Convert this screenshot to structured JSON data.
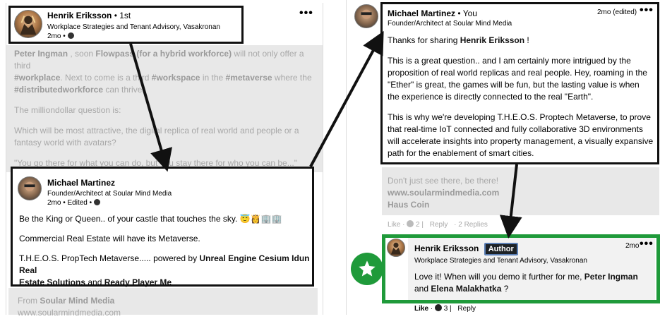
{
  "left_post": {
    "author_name": "Henrik Eriksson",
    "author_degree": "• 1st",
    "author_title": "Workplace Strategies and Tenant Advisory, Vasakronan",
    "author_meta": "2mo •",
    "more": "•••",
    "para1_a": "Peter Ingman",
    "para1_b": " , soon ",
    "para1_c": "Flowpass (for a hybrid workforce)",
    "para1_d": " will not only offer a third",
    "para1_e": "#workplace",
    "para1_f": ". Next to come is a third ",
    "para1_g": "#workspace",
    "para1_h": " in the ",
    "para1_i": "#metaverse",
    "para1_j": " where the",
    "para1_k": "#distributedworkforce",
    "para1_l": " can thrive.",
    "para2": "The milliondollar question is:",
    "para3_line1": "Which will be most attractive, the digital replica of real world and people or a",
    "para3_line2": "fantasy world with avatars?",
    "para4": "\"You go there for what you can do, but you stay there for who you can be...\""
  },
  "left_comment": {
    "author_name": "Michael Martinez",
    "author_title": "Founder/Architect at Soular Mind Media",
    "author_meta": "2mo • Edited •",
    "line1": "Be the King or Queen.. of your castle that touches the sky.",
    "line1_emoji": "😇👸🏢🏢",
    "line2": "Commercial Real Estate will have its Metaverse.",
    "line3_a": "T.H.E.O.S. PropTech Metaverse..... powered by ",
    "line3_b": "Unreal Engine Cesium Idun Real",
    "line3_c": "Estate Solutions",
    "line3_d": " and ",
    "line3_e": "Ready Player Me",
    "below_a": "From ",
    "below_b": "Soular Mind Media",
    "below_c": "www.soularmindmedia.com"
  },
  "right_comment": {
    "author_name": "Michael Martinez",
    "author_degree": "• You",
    "author_title": "Founder/Architect at Soular Mind Media",
    "time": "2mo (edited)",
    "more": "•••",
    "thanks_a": "Thanks for sharing ",
    "thanks_b": "Henrik Eriksson",
    "thanks_c": " !",
    "p1_l1": "This is a great question.. and I am certainly more intrigued by the",
    "p1_l2": "proposition of real world replicas and real people. Hey, roaming in the",
    "p1_l3": "\"Ether\" is great, the games will be fun, but the lasting value is when",
    "p1_l4": "the experience is directly connected to the real \"Earth\".",
    "p2_l1": "This is why we're developing T.H.E.O.S. Proptech Metaverse, to prove",
    "p2_l2": "that real-time IoT connected and fully collaborative 3D environments",
    "p2_l3": "will accelerate insights into property management, a visually expansive",
    "p2_l4": "path for the enablement of smart cities.",
    "below_l1": "Don't just see there, be there!",
    "below_l2": "www.soularmindmedia.com",
    "below_l3": "Haus Coin",
    "actions_like": "Like",
    "actions_sep": "·",
    "actions_count": "2",
    "actions_reply": "Reply",
    "actions_replies": "· 2 Replies"
  },
  "reply": {
    "author_name": "Henrik Eriksson",
    "author_badge": "Author",
    "author_title": "Workplace Strategies and Tenant Advisory, Vasakronan",
    "time": "2mo",
    "more": "•••",
    "text_a": "Love it! When will you demo it further for me, ",
    "text_b": "Peter Ingman",
    "text_c": "and ",
    "text_d": "Elena Malakhatka",
    "text_e": " ?",
    "actions_like": "Like",
    "actions_count": "3",
    "actions_reply": "Reply"
  },
  "colors": {
    "frame": "#111111",
    "highlight_frame": "#1f9a3a",
    "star_badge": "#1f9a3a",
    "faded_text": "#a8a8a8",
    "grey_panel": "#e8e8e8"
  }
}
